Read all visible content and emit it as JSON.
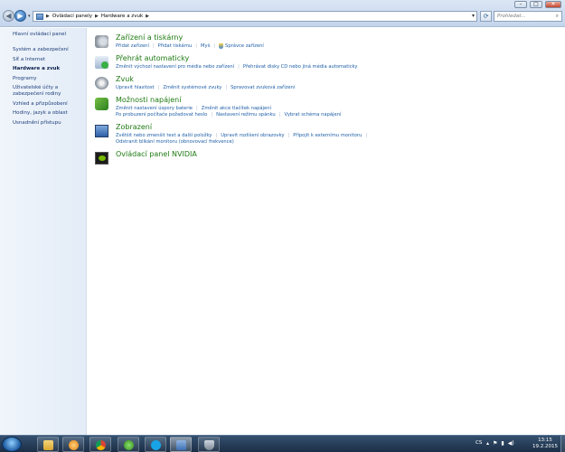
{
  "address_bar": {
    "crumbs": [
      "Ovládací panely",
      "Hardware a zvuk"
    ],
    "search_placeholder": "Prohledat..."
  },
  "sidebar": {
    "home": "Hlavní ovládací panel",
    "items": [
      {
        "label": "Systém a zabezpečení"
      },
      {
        "label": "Síť a Internet"
      },
      {
        "label": "Hardware a zvuk",
        "current": true
      },
      {
        "label": "Programy"
      },
      {
        "label": "Uživatelské účty a zabezpečení rodiny"
      },
      {
        "label": "Vzhled a přizpůsobení"
      },
      {
        "label": "Hodiny, jazyk a oblast"
      },
      {
        "label": "Usnadnění přístupu"
      }
    ]
  },
  "categories": [
    {
      "title": "Zařízení a tiskárny",
      "icon": "devices-printers-icon",
      "links": [
        "Přidat zařízení",
        "Přidat tiskárnu",
        "Myš",
        "Správce zařízení"
      ],
      "links2": []
    },
    {
      "title": "Přehrát automaticky",
      "icon": "autoplay-icon",
      "links": [
        "Změnit výchozí nastavení pro média nebo zařízení",
        "Přehrávat disky CD nebo jiná média automaticky"
      ],
      "links2": []
    },
    {
      "title": "Zvuk",
      "icon": "speaker-icon",
      "links": [
        "Upravit hlasitost",
        "Změnit systémové zvuky",
        "Spravovat zvuková zařízení"
      ],
      "links2": []
    },
    {
      "title": "Možnosti napájení",
      "icon": "power-options-icon",
      "links": [
        "Změnit nastavení úspory baterie",
        "Změnit akce tlačítek napájení"
      ],
      "links2": [
        "Po probuzení počítače požadovat heslo",
        "Nastavení režimu spánku",
        "Vybrat schéma napájení"
      ]
    },
    {
      "title": "Zobrazení",
      "icon": "display-icon",
      "links": [
        "Zvětšit nebo zmenšit text a další položky",
        "Upravit rozlišení obrazovky",
        "Připojit k externímu monitoru"
      ],
      "links2": [
        "Odstranit blikání monitoru (obnovovací frekvence)"
      ]
    },
    {
      "title": "Ovládací panel NVIDIA",
      "icon": "nvidia-icon",
      "links": [],
      "links2": []
    }
  ],
  "taskbar": {
    "apps": [
      "explorer-icon",
      "media-player-icon",
      "chrome-icon",
      "game-icon",
      "skype-icon",
      "control-panel-icon",
      "security-icon"
    ],
    "language": "CS",
    "time": "13:15",
    "date": "19.2.2015"
  }
}
